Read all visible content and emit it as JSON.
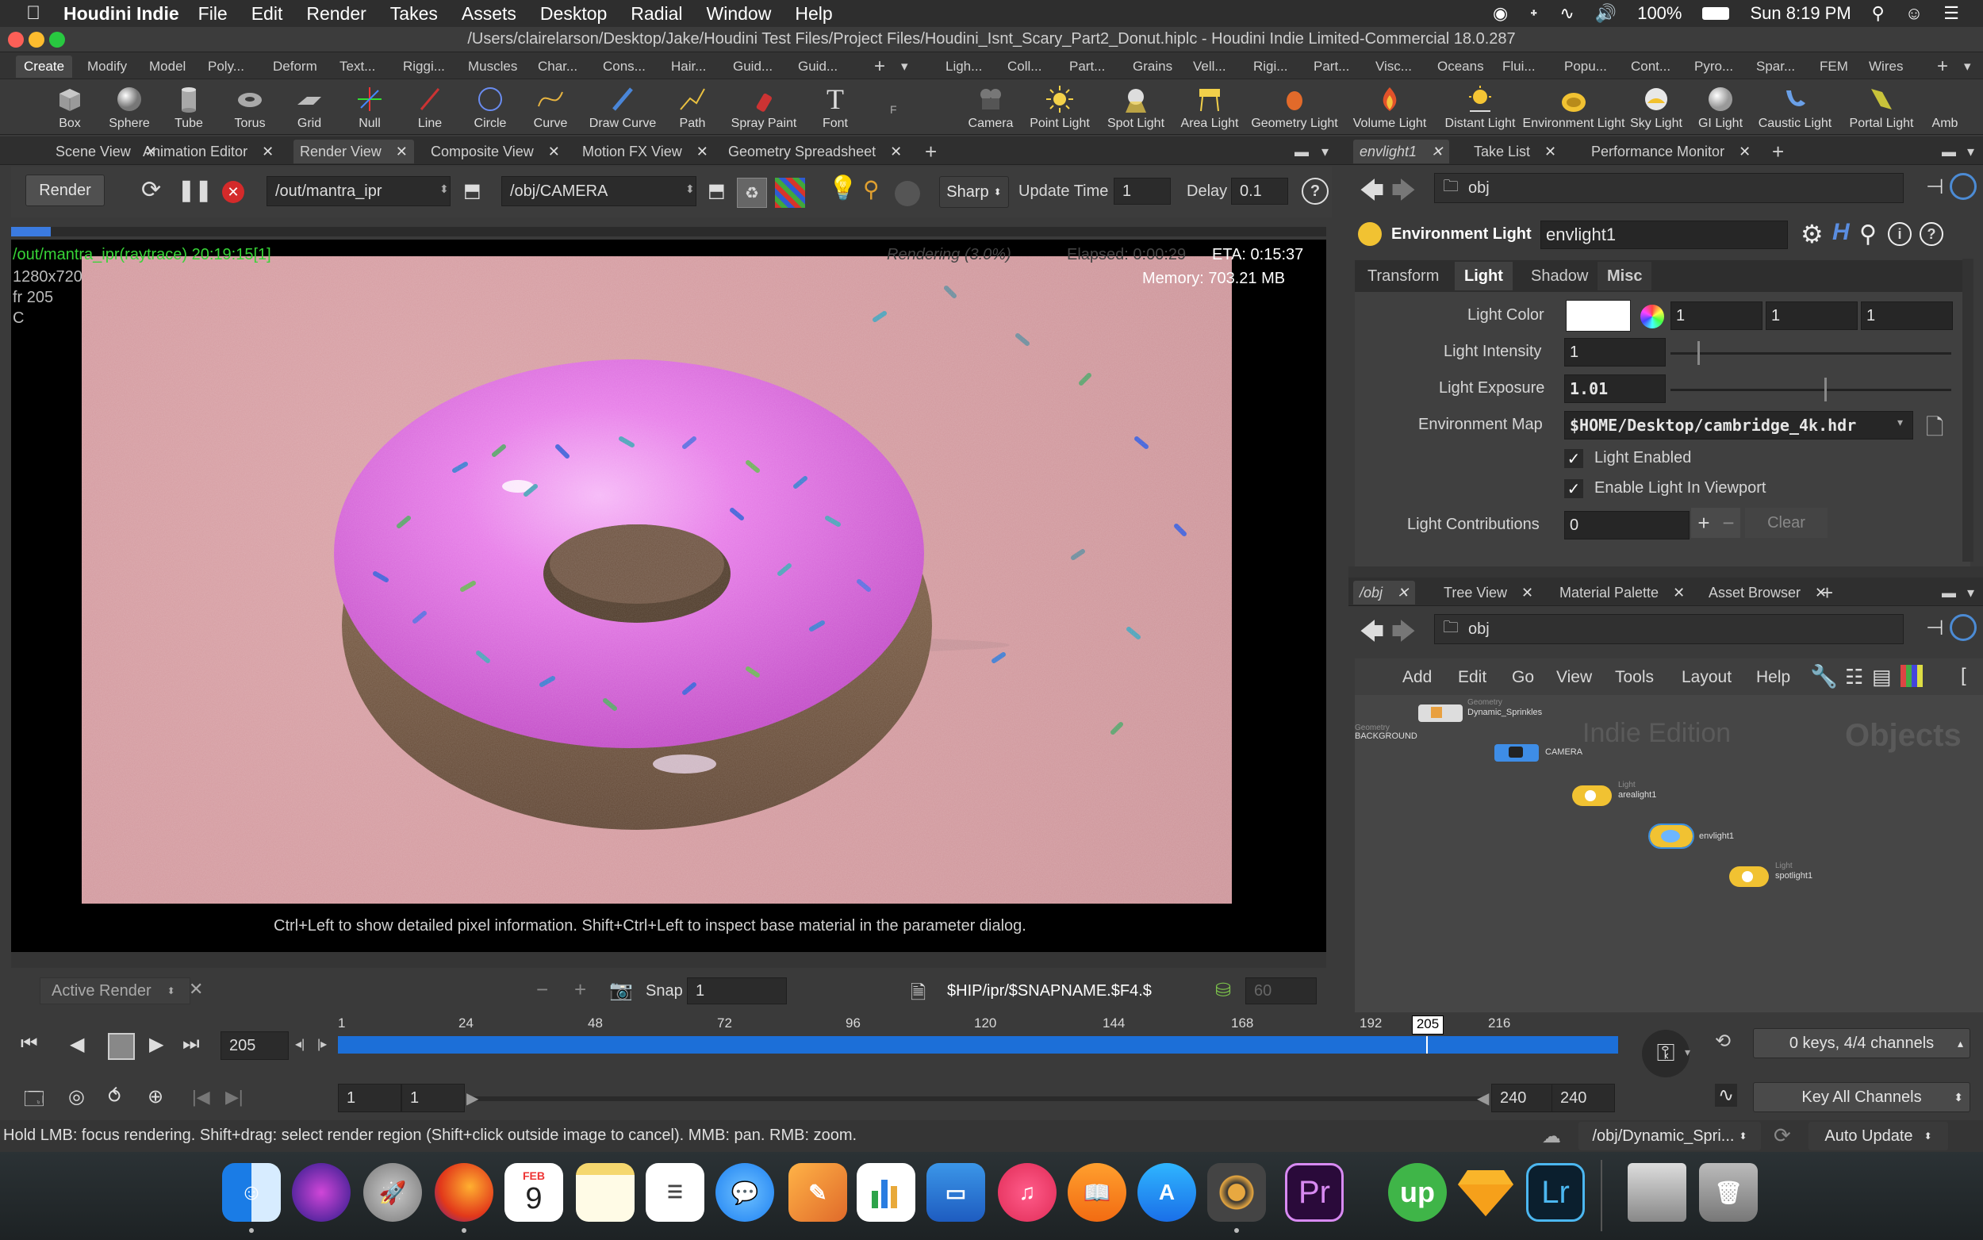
{
  "menubar": {
    "app_name": "Houdini Indie",
    "items": [
      "File",
      "Edit",
      "Render",
      "Takes",
      "Assets",
      "Desktop",
      "Radial",
      "Window",
      "Help"
    ],
    "battery": "100%",
    "clock": "Sun 8:19 PM"
  },
  "window": {
    "title": "/Users/clairelarson/Desktop/Jake/Houdini Test Files/Project Files/Houdini_Isnt_Scary_Part2_Donut.hiplc - Houdini Indie Limited-Commercial 18.0.287"
  },
  "shelf": {
    "left_tabs": [
      "Create",
      "Modify",
      "Model",
      "Poly...",
      "Deform",
      "Text...",
      "Riggi...",
      "Muscles",
      "Char...",
      "Cons...",
      "Hair...",
      "Guid...",
      "Guid..."
    ],
    "right_tabs": [
      "Ligh...",
      "Coll...",
      "Part...",
      "Grains",
      "Vell...",
      "Rigi...",
      "Part...",
      "Visc...",
      "Oceans",
      "Flui...",
      "Popu...",
      "Cont...",
      "Pyro...",
      "Spar...",
      "FEM",
      "Wires"
    ],
    "left_tools": [
      "Box",
      "Sphere",
      "Tube",
      "Torus",
      "Grid",
      "Null",
      "Line",
      "Circle",
      "Curve",
      "Draw Curve",
      "Path",
      "Spray Paint",
      "Font"
    ],
    "right_tools": [
      "Camera",
      "Point Light",
      "Spot Light",
      "Area Light",
      "Geometry Light",
      "Volume Light",
      "Distant Light",
      "Environment Light",
      "Sky Light",
      "GI Light",
      "Caustic Light",
      "Portal Light",
      "Amb"
    ]
  },
  "left_pane_tabs": [
    "Scene View",
    "Animation Editor",
    "Render View",
    "Composite View",
    "Motion FX View",
    "Geometry Spreadsheet"
  ],
  "render_toolbar": {
    "render_label": "Render",
    "rop_path": "/out/mantra_ipr",
    "camera_path": "/obj/CAMERA",
    "sharp_label": "Sharp",
    "update_time_label": "Update Time",
    "update_time_value": "1",
    "delay_label": "Delay",
    "delay_value": "0.1"
  },
  "render_view": {
    "ipr_label": "/out/mantra_ipr(raytrace) 20:19:15[1]",
    "resolution": "1280x720",
    "frame": "fr 205",
    "channel": "C",
    "rendering": "Rendering (3.0%)",
    "elapsed": "Elapsed: 0:00:29",
    "eta": "ETA: 0:15:37",
    "memory": "Memory: 703.21 MB",
    "hint": "Ctrl+Left to show detailed pixel information. Shift+Ctrl+Left to inspect base material in the parameter dialog."
  },
  "render_bottom": {
    "active_render": "Active Render",
    "snap_label": "Snap",
    "snap_value": "1",
    "snap_path": "$HIP/ipr/$SNAPNAME.$F4.$",
    "count": "60"
  },
  "right_top_tabs": [
    "envlight1",
    "Take List",
    "Performance Monitor"
  ],
  "right_top_path": "obj",
  "parm": {
    "node_type": "Environment Light",
    "node_name": "envlight1",
    "tabs": [
      "Transform",
      "Light",
      "Shadow",
      "Misc"
    ],
    "light_color_label": "Light Color",
    "light_color_values": [
      "1",
      "1",
      "1"
    ],
    "intensity_label": "Light Intensity",
    "intensity_value": "1",
    "exposure_label": "Light Exposure",
    "exposure_value": "1.01",
    "envmap_label": "Environment Map",
    "envmap_value": "$HOME/Desktop/cambridge_4k.hdr",
    "light_enabled": "Light Enabled",
    "light_in_viewport": "Enable Light In Viewport",
    "contrib_label": "Light Contributions",
    "contrib_value": "0",
    "clear_label": "Clear"
  },
  "right_bottom_tabs": [
    "/obj",
    "Tree View",
    "Material Palette",
    "Asset Browser"
  ],
  "right_bottom_path": "obj",
  "network": {
    "menu": [
      "Add",
      "Edit",
      "Go",
      "View",
      "Tools",
      "Layout",
      "Help"
    ],
    "watermark_edition": "Indie Edition",
    "watermark_context": "Objects",
    "nodes": [
      {
        "cat": "Geometry",
        "name": "Dynamic_Sprinkles"
      },
      {
        "cat": "Geometry",
        "name": "BACKGROUND"
      },
      {
        "cat": "",
        "name": "CAMERA"
      },
      {
        "cat": "Light",
        "name": "arealight1"
      },
      {
        "cat": "",
        "name": "envlight1"
      },
      {
        "cat": "Light",
        "name": "spotlight1"
      }
    ]
  },
  "timeline": {
    "current_frame": "205",
    "ticks": [
      "1",
      "24",
      "48",
      "72",
      "96",
      "120",
      "144",
      "168",
      "192",
      "216"
    ],
    "marker": "205",
    "range_start": "1",
    "range_start2": "1",
    "range_end": "240",
    "range_end2": "240",
    "keys_info": "0 keys, 4/4 channels",
    "key_all": "Key All Channels"
  },
  "status": {
    "message": "Hold LMB: focus rendering. Shift+drag: select render region (Shift+click outside image to cancel). MMB: pan. RMB: zoom.",
    "node_path": "/obj/Dynamic_Spri...",
    "update_mode": "Auto Update"
  },
  "dock": {
    "calendar_month": "FEB",
    "calendar_day": "9",
    "pr_label": "Pr",
    "lr_label": "Lr",
    "up_label": "up"
  }
}
